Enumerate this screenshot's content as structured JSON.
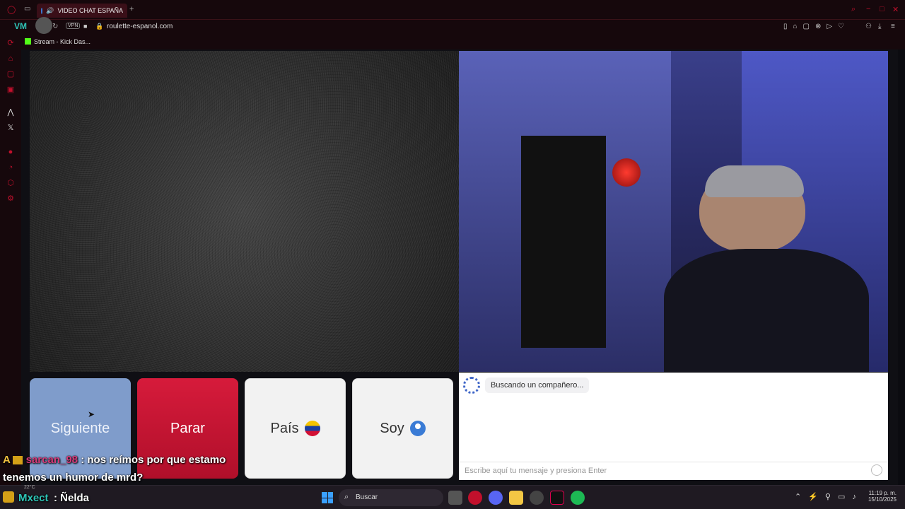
{
  "browser": {
    "tab_title": "VIDEO CHAT ESPAÑA",
    "new_tab": "+",
    "vpn_label": "VPN",
    "url": "roulette-espanol.com",
    "bookmark": "Stream - Kick Das..."
  },
  "controls": {
    "next_label": "Siguiente",
    "stop_label": "Parar",
    "country_label": "País",
    "gender_label": "Soy"
  },
  "chat": {
    "status": "Buscando un compañero...",
    "input_placeholder": "Escribe aquí tu mensaje y presiona Enter"
  },
  "stream_overlay": {
    "user": "sarcan_98",
    "message_line1": ": nos reímos por que estamo",
    "message_line2": "tenemos un humor de mrd?",
    "user2": "Mxect",
    "message2": ": Ñelda",
    "temp": "22°C"
  },
  "taskbar": {
    "search": "Buscar",
    "time": "11:19 p. m.",
    "date": "15/10/2025"
  },
  "colors": {
    "accent": "#c2102c",
    "next_button": "#7f9ccb",
    "stop_button": "#d61b3b"
  }
}
